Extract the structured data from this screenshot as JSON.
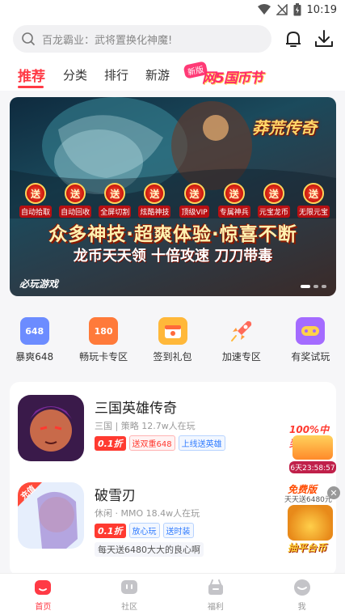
{
  "status_bar": {
    "time": "10:19"
  },
  "search": {
    "placeholder": "百龙霸业：武将置换化神魔!"
  },
  "tabs": [
    {
      "label": "推荐",
      "active": true
    },
    {
      "label": "分类"
    },
    {
      "label": "排行"
    },
    {
      "label": "新游"
    }
  ],
  "promo": {
    "badge": "新版",
    "text": "网5国币节"
  },
  "banner": {
    "logo": "莽荒传奇",
    "features": [
      "自动拾取",
      "自动回收",
      "全屏切割",
      "炫酷神技",
      "顶级VIP",
      "专属神兵",
      "元宝龙币",
      "无限元宝"
    ],
    "feature_seal": "送",
    "slogan1": "众多神技·超爽体验·惊喜不断",
    "slogan2": "龙币天天领 十倍攻速 刀刀带毒",
    "brand": "必玩游戏"
  },
  "quick_entries": [
    {
      "label": "暴爽648",
      "icon_text": "648",
      "color": "#6c8cff"
    },
    {
      "label": "畅玩卡专区",
      "icon_text": "180",
      "color": "#ff7a3a"
    },
    {
      "label": "签到礼包",
      "icon_text": "",
      "color": "#ffb83a"
    },
    {
      "label": "加速专区",
      "icon_text": "",
      "color": "#ff6a5a"
    },
    {
      "label": "有奖试玩",
      "icon_text": "",
      "color": "#a46bff"
    }
  ],
  "games": [
    {
      "name": "三国英雄传奇",
      "meta": "三国 | 策略  12.7w人在玩",
      "discount": "0.1折",
      "tag1": "送双重648",
      "tag2": "上线送英雄"
    },
    {
      "name": "破雪刃",
      "meta": "休闲 · MMO  18.4w人在玩",
      "discount": "0.1折",
      "tag1": "放心玩",
      "tag2": "送时装",
      "note": "每天送6480大大的良心啊",
      "badge": "充值"
    }
  ],
  "float_ads": {
    "ad1_title": "100%中奖",
    "ad1_timer": "6天23:58:57",
    "ad2_title": "免费版",
    "ad2_sub": "天天送6480元",
    "ad2_cta": "抽平台币"
  },
  "bottom_nav": [
    {
      "label": "首页",
      "active": true
    },
    {
      "label": "社区"
    },
    {
      "label": "福利"
    },
    {
      "label": "我"
    }
  ],
  "colors": {
    "accent": "#ff3a45"
  }
}
